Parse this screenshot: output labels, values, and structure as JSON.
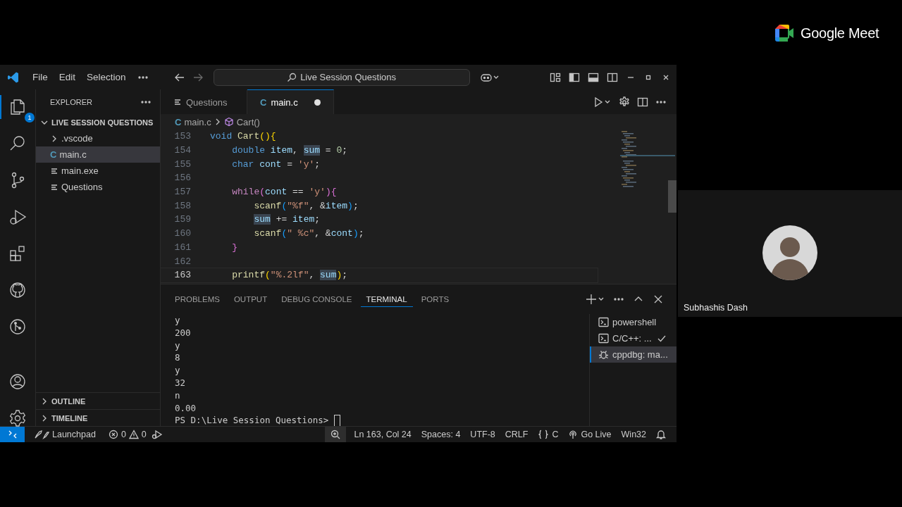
{
  "titlebar": {
    "menu": [
      "File",
      "Edit",
      "Selection"
    ],
    "search": "Live Session Questions"
  },
  "activity_bar": {
    "badge": "1"
  },
  "explorer": {
    "title": "EXPLORER",
    "root": {
      "label": "LIVE SESSION QUESTIONS",
      "expanded": true,
      "children": [
        {
          "label": ".vscode",
          "kind": "folder",
          "expanded": false,
          "selected": false
        },
        {
          "label": "main.c",
          "kind": "c",
          "icon": "C",
          "selected": true
        },
        {
          "label": "main.exe",
          "kind": "text",
          "selected": false
        },
        {
          "label": "Questions",
          "kind": "text",
          "selected": false
        }
      ]
    },
    "sections": [
      {
        "label": "OUTLINE",
        "expanded": false
      },
      {
        "label": "TIMELINE",
        "expanded": false
      }
    ]
  },
  "editor": {
    "tabs": [
      {
        "label": "Questions",
        "kind": "text",
        "selected": false,
        "modified": false
      },
      {
        "label": "main.c",
        "kind": "c",
        "icon": "C",
        "selected": true,
        "modified": true
      }
    ],
    "breadcrumb": [
      {
        "label": "main.c",
        "kind": "c",
        "icon": "C"
      },
      {
        "label": "Cart()",
        "kind": "method"
      }
    ],
    "lines": [
      {
        "number": "153",
        "current": false,
        "tokens": [
          {
            "text": "void ",
            "kind": "kw"
          },
          {
            "text": "Cart",
            "kind": "fn"
          },
          {
            "text": "(){",
            "kind": "br1"
          }
        ]
      },
      {
        "number": "154",
        "current": false,
        "tokens": [
          {
            "text": "    double ",
            "kind": "kw"
          },
          {
            "text": "item",
            "kind": "var"
          },
          {
            "text": ", ",
            "kind": "plain"
          },
          {
            "text": "sum",
            "kind": "var_hl"
          },
          {
            "text": " = ",
            "kind": "plain"
          },
          {
            "text": "0",
            "kind": "num"
          },
          {
            "text": ";",
            "kind": "plain"
          }
        ]
      },
      {
        "number": "155",
        "current": false,
        "tokens": [
          {
            "text": "    char ",
            "kind": "kw"
          },
          {
            "text": "cont",
            "kind": "var"
          },
          {
            "text": " = ",
            "kind": "plain"
          },
          {
            "text": "'y'",
            "kind": "str"
          },
          {
            "text": ";",
            "kind": "plain"
          }
        ]
      },
      {
        "number": "156",
        "current": false
      },
      {
        "number": "157",
        "current": false,
        "tokens": [
          {
            "text": "    while",
            "kind": "ctl"
          },
          {
            "text": "(",
            "kind": "br2"
          },
          {
            "text": "cont",
            "kind": "var"
          },
          {
            "text": " == ",
            "kind": "plain"
          },
          {
            "text": "'y'",
            "kind": "str"
          },
          {
            "text": "){",
            "kind": "br2"
          }
        ]
      },
      {
        "number": "158",
        "current": false,
        "tokens": [
          {
            "text": "        scanf",
            "kind": "fn"
          },
          {
            "text": "(",
            "kind": "br3"
          },
          {
            "text": "\"%f\"",
            "kind": "str"
          },
          {
            "text": ", &",
            "kind": "plain"
          },
          {
            "text": "item",
            "kind": "var"
          },
          {
            "text": ")",
            "kind": "br3"
          },
          {
            "text": ";",
            "kind": "plain"
          }
        ]
      },
      {
        "number": "159",
        "current": false,
        "tokens": [
          {
            "text": "        sum",
            "kind": "var_hl"
          },
          {
            "text": " += ",
            "kind": "plain"
          },
          {
            "text": "item",
            "kind": "var"
          },
          {
            "text": ";",
            "kind": "plain"
          }
        ]
      },
      {
        "number": "160",
        "current": false,
        "tokens": [
          {
            "text": "        scanf",
            "kind": "fn"
          },
          {
            "text": "(",
            "kind": "br3"
          },
          {
            "text": "\" %c\"",
            "kind": "str"
          },
          {
            "text": ", &",
            "kind": "plain"
          },
          {
            "text": "cont",
            "kind": "var"
          },
          {
            "text": ")",
            "kind": "br3"
          },
          {
            "text": ";",
            "kind": "plain"
          }
        ]
      },
      {
        "number": "161",
        "current": false,
        "tokens": [
          {
            "text": "    }",
            "kind": "br2"
          }
        ]
      },
      {
        "number": "162",
        "current": false
      },
      {
        "number": "163",
        "current": true,
        "tokens": [
          {
            "text": "    printf",
            "kind": "fn"
          },
          {
            "text": "(",
            "kind": "br1"
          },
          {
            "text": "\"%.2lf\"",
            "kind": "str"
          },
          {
            "text": ", ",
            "kind": "plain"
          },
          {
            "text": "sum",
            "kind": "var_hl"
          },
          {
            "text": ")",
            "kind": "br1"
          },
          {
            "text": ";",
            "kind": "plain"
          }
        ]
      }
    ]
  },
  "panel": {
    "tabs": [
      {
        "label": "PROBLEMS",
        "selected": false
      },
      {
        "label": "OUTPUT",
        "selected": false
      },
      {
        "label": "DEBUG CONSOLE",
        "selected": false
      },
      {
        "label": "TERMINAL",
        "selected": true
      },
      {
        "label": "PORTS",
        "selected": false
      }
    ],
    "output": [
      "y",
      "200",
      "y",
      "8",
      "y",
      "32",
      "n",
      "0.00"
    ],
    "prompt": "PS D:\\Live Session Questions>",
    "terminals": [
      {
        "label": "powershell",
        "kind": "shell",
        "selected": false,
        "checked": false
      },
      {
        "label": "C/C++: ...",
        "kind": "shell",
        "selected": false,
        "checked": true
      },
      {
        "label": "cppdbg: ma...",
        "kind": "debug",
        "selected": true,
        "checked": false
      }
    ]
  },
  "status_bar": {
    "launchpad": "Launchpad",
    "errors": "0",
    "warnings": "0",
    "items": [
      "Ln 163, Col 24",
      "Spaces: 4",
      "UTF-8",
      "CRLF"
    ],
    "language": "C",
    "go_live": "Go Live",
    "platform": "Win32"
  },
  "meet": {
    "brand": "Google Meet",
    "participant": {
      "name": "Subhashis Dash"
    }
  }
}
